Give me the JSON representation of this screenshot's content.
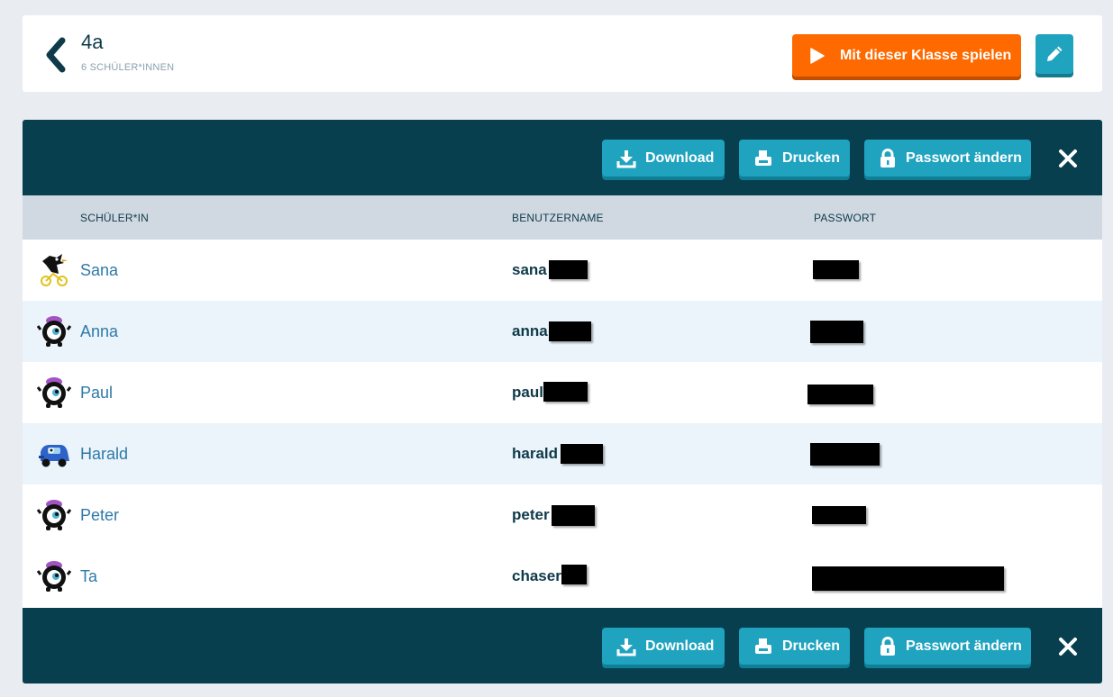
{
  "header": {
    "title": "4a",
    "subtitle": "6 SCHÜLER*INNEN",
    "play_label": "Mit dieser Klasse spielen"
  },
  "toolbar": {
    "download_label": "Download",
    "print_label": "Drucken",
    "password_label": "Passwort ändern"
  },
  "table": {
    "columns": [
      "SCHÜLER*IN",
      "BENUTZERNAME",
      "PASSWORT"
    ],
    "rows": [
      {
        "name": "Sana",
        "username": "sana",
        "avatar": "crow-bike-avatar"
      },
      {
        "name": "Anna",
        "username": "anna",
        "avatar": "eye-monster-avatar"
      },
      {
        "name": "Paul",
        "username": "paul",
        "avatar": "eye-monster-avatar"
      },
      {
        "name": "Harald",
        "username": "harald",
        "avatar": "blue-car-avatar"
      },
      {
        "name": "Peter",
        "username": "peter",
        "avatar": "eye-monster-avatar"
      },
      {
        "name": "Ta",
        "username": "chaser",
        "avatar": "eye-monster-avatar"
      }
    ]
  },
  "colors": {
    "toolbar_bg": "#073f4f",
    "accent_teal": "#1fa3bf",
    "play_orange": "#ff6a00",
    "link_blue": "#2f7aa8"
  }
}
